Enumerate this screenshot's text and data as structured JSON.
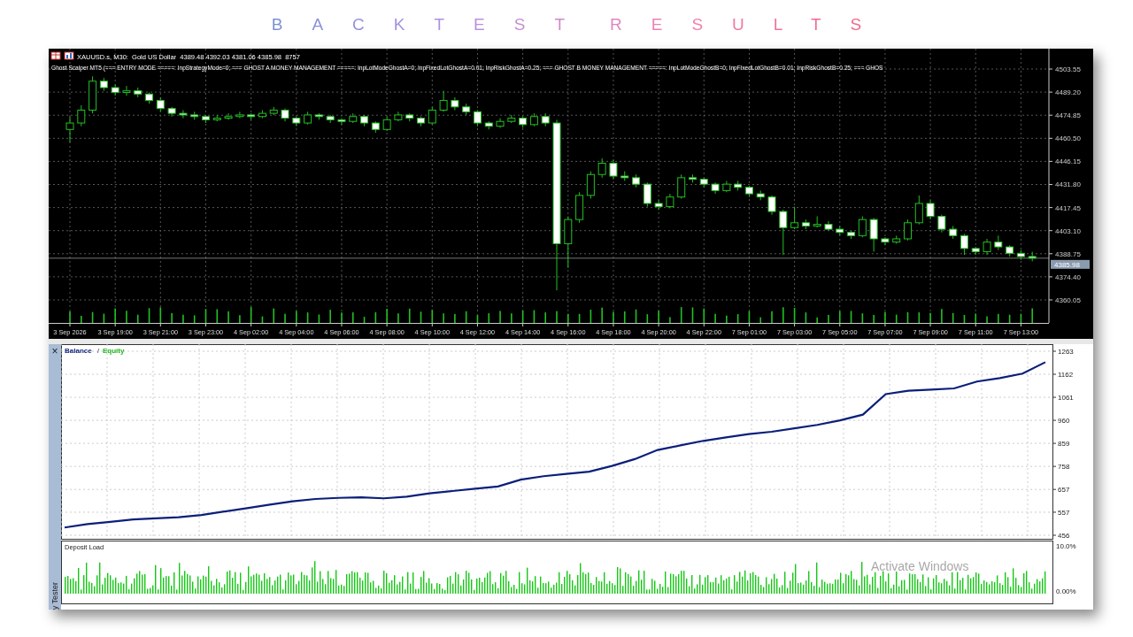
{
  "title": "BACKTEST RESULTS",
  "chart": {
    "symbol_line": "XAUUSD.s, M30:  Gold US Dollar  4389.48 4392.03 4381.06 4385.98  8757",
    "indicator_line": "Ghost Scalper MT5 (=== ENTRY MODE =====: InpStrategyMode=0; === GHOST A MONEY MANAGEMENT =====: InpLotModeGhostA=0; InpFixedLotGhostA=0.01; InpRiskGhostA=0.25; === GHOST B MONEY MANAGEMENT =====: InpLotModeGhostB=0; InpFixedLotGhostB=0.01; InpRiskGhostB=0.25; === GHOS",
    "current_price": "4385.98",
    "chart_data": {
      "type": "candlestick",
      "grid": true,
      "ylim": [
        4345.75,
        4516.2
      ],
      "yticks": [
        {
          "value": 4503.55,
          "label": "4503.55"
        },
        {
          "value": 4489.2,
          "label": "4489.20"
        },
        {
          "value": 4474.85,
          "label": "4474.85"
        },
        {
          "value": 4460.5,
          "label": "4460.50"
        },
        {
          "value": 4446.15,
          "label": "4446.15"
        },
        {
          "value": 4431.8,
          "label": "4431.80"
        },
        {
          "value": 4417.45,
          "label": "4417.45"
        },
        {
          "value": 4403.1,
          "label": "4403.10"
        },
        {
          "value": 4388.75,
          "label": "4388.75"
        },
        {
          "value": 4374.4,
          "label": "4374.40"
        },
        {
          "value": 4360.05,
          "label": "4360.05"
        }
      ],
      "categories": [
        "3 Sep 2026",
        null,
        null,
        null,
        "3 Sep 19:00",
        null,
        null,
        null,
        "3 Sep 21:00",
        null,
        null,
        null,
        "3 Sep 23:00",
        null,
        null,
        null,
        "4 Sep 02:00",
        null,
        null,
        null,
        "4 Sep 04:00",
        null,
        null,
        null,
        "4 Sep 06:00",
        null,
        null,
        null,
        "4 Sep 08:00",
        null,
        null,
        null,
        "4 Sep 10:00",
        null,
        null,
        null,
        "4 Sep 12:00",
        null,
        null,
        null,
        "4 Sep 14:00",
        null,
        null,
        null,
        "4 Sep 16:00",
        null,
        null,
        null,
        "4 Sep 18:00",
        null,
        null,
        null,
        "4 Sep 20:00",
        null,
        null,
        null,
        "4 Sep 22:00",
        null,
        null,
        null,
        "7 Sep 01:00",
        null,
        null,
        null,
        "7 Sep 03:00",
        null,
        null,
        null,
        "7 Sep 05:00",
        null,
        null,
        null,
        "7 Sep 07:00",
        null,
        null,
        null,
        "7 Sep 09:00",
        null,
        null,
        null,
        "7 Sep 11:00",
        null,
        null,
        null,
        "7 Sep 13:00",
        null
      ],
      "ohlc": [
        [
          4466,
          4474,
          4458,
          4470
        ],
        [
          4470,
          4481,
          4468,
          4478
        ],
        [
          4478,
          4499,
          4476,
          4496
        ],
        [
          4496,
          4498,
          4490,
          4492
        ],
        [
          4492,
          4494,
          4487,
          4489
        ],
        [
          4489,
          4493,
          4487,
          4490
        ],
        [
          4490,
          4492,
          4486,
          4488
        ],
        [
          4488,
          4489,
          4482,
          4484
        ],
        [
          4484,
          4486,
          4477,
          4479
        ],
        [
          4479,
          4480,
          4474,
          4476
        ],
        [
          4476,
          4478,
          4473,
          4475
        ],
        [
          4475,
          4477,
          4472,
          4474
        ],
        [
          4474,
          4475,
          4470,
          4472
        ],
        [
          4472,
          4475,
          4471,
          4473
        ],
        [
          4473,
          4476,
          4472,
          4474
        ],
        [
          4474,
          4477,
          4473,
          4475
        ],
        [
          4475,
          4476,
          4472,
          4474
        ],
        [
          4474,
          4478,
          4473,
          4476
        ],
        [
          4476,
          4480,
          4475,
          4478
        ],
        [
          4478,
          4479,
          4471,
          4473
        ],
        [
          4473,
          4474,
          4468,
          4470
        ],
        [
          4470,
          4477,
          4469,
          4475
        ],
        [
          4475,
          4476,
          4472,
          4474
        ],
        [
          4474,
          4475,
          4470,
          4472
        ],
        [
          4472,
          4473,
          4469,
          4471
        ],
        [
          4471,
          4476,
          4470,
          4474
        ],
        [
          4474,
          4475,
          4468,
          4470
        ],
        [
          4470,
          4471,
          4464,
          4466
        ],
        [
          4466,
          4474,
          4465,
          4472
        ],
        [
          4472,
          4477,
          4471,
          4475
        ],
        [
          4475,
          4476,
          4471,
          4473
        ],
        [
          4473,
          4474,
          4468,
          4470
        ],
        [
          4470,
          4480,
          4469,
          4478
        ],
        [
          4478,
          4490,
          4477,
          4484
        ],
        [
          4484,
          4486,
          4478,
          4480
        ],
        [
          4480,
          4482,
          4475,
          4477
        ],
        [
          4477,
          4478,
          4468,
          4470
        ],
        [
          4470,
          4471,
          4466,
          4468
        ],
        [
          4468,
          4473,
          4467,
          4471
        ],
        [
          4471,
          4475,
          4470,
          4473
        ],
        [
          4473,
          4474,
          4467,
          4469
        ],
        [
          4469,
          4476,
          4468,
          4474
        ],
        [
          4474,
          4476,
          4468,
          4470
        ],
        [
          4470,
          4472,
          4366,
          4395
        ],
        [
          4395,
          4412,
          4380,
          4410
        ],
        [
          4410,
          4427,
          4408,
          4425
        ],
        [
          4425,
          4440,
          4423,
          4438
        ],
        [
          4438,
          4448,
          4436,
          4445
        ],
        [
          4445,
          4447,
          4435,
          4437
        ],
        [
          4437,
          4440,
          4434,
          4436
        ],
        [
          4436,
          4438,
          4430,
          4432
        ],
        [
          4432,
          4433,
          4418,
          4420
        ],
        [
          4420,
          4422,
          4416,
          4418
        ],
        [
          4418,
          4426,
          4417,
          4424
        ],
        [
          4424,
          4438,
          4423,
          4436
        ],
        [
          4436,
          4438,
          4433,
          4435
        ],
        [
          4435,
          4436,
          4430,
          4432
        ],
        [
          4432,
          4433,
          4426,
          4428
        ],
        [
          4428,
          4434,
          4427,
          4432
        ],
        [
          4432,
          4434,
          4428,
          4430
        ],
        [
          4430,
          4431,
          4424,
          4426
        ],
        [
          4426,
          4428,
          4422,
          4424
        ],
        [
          4424,
          4425,
          4413,
          4415
        ],
        [
          4415,
          4416,
          4388,
          4405
        ],
        [
          4405,
          4418,
          4404,
          4408
        ],
        [
          4408,
          4410,
          4404,
          4406
        ],
        [
          4406,
          4412,
          4405,
          4407
        ],
        [
          4407,
          4409,
          4403,
          4404
        ],
        [
          4404,
          4406,
          4400,
          4402
        ],
        [
          4402,
          4403,
          4398,
          4400
        ],
        [
          4400,
          4412,
          4399,
          4410
        ],
        [
          4410,
          4411,
          4390,
          4398
        ],
        [
          4398,
          4399,
          4394,
          4396
        ],
        [
          4396,
          4400,
          4395,
          4398
        ],
        [
          4398,
          4410,
          4397,
          4408
        ],
        [
          4408,
          4425,
          4407,
          4420
        ],
        [
          4420,
          4422,
          4410,
          4412
        ],
        [
          4412,
          4413,
          4402,
          4404
        ],
        [
          4404,
          4406,
          4398,
          4400
        ],
        [
          4400,
          4401,
          4388,
          4392
        ],
        [
          4392,
          4393,
          4388,
          4390
        ],
        [
          4390,
          4398,
          4388,
          4396
        ],
        [
          4396,
          4400,
          4391,
          4393
        ],
        [
          4393,
          4394,
          4387,
          4389
        ],
        [
          4389,
          4391,
          4385,
          4387
        ],
        [
          4387,
          4390,
          4384,
          4386
        ]
      ]
    }
  },
  "tester": {
    "close": "×",
    "tab": "y Tester",
    "balance_chart": {
      "legend_separator": "/",
      "equity_legend": {
        "label": "Equity",
        "color": "#22b422"
      },
      "chart_data": {
        "type": "line",
        "grid": true,
        "ylim": [
          456,
          1263
        ],
        "yticks": [
          456,
          557,
          657,
          758,
          859,
          960,
          1061,
          1162,
          1263
        ],
        "series": [
          {
            "name": "Balance",
            "color": "#0b1f7a",
            "values": [
              490,
              505,
              515,
              525,
              530,
              535,
              545,
              560,
              575,
              590,
              605,
              615,
              620,
              622,
              618,
              625,
              640,
              650,
              660,
              670,
              700,
              715,
              725,
              735,
              760,
              790,
              830,
              850,
              870,
              885,
              900,
              910,
              925,
              940,
              960,
              985,
              1075,
              1090,
              1095,
              1100,
              1130,
              1145,
              1165,
              1215
            ]
          }
        ]
      }
    },
    "deposit_load": {
      "title": "Deposit Load",
      "ticks": [
        "10.0%",
        "0.00%"
      ]
    }
  },
  "os_notice": "Activate Windows"
}
